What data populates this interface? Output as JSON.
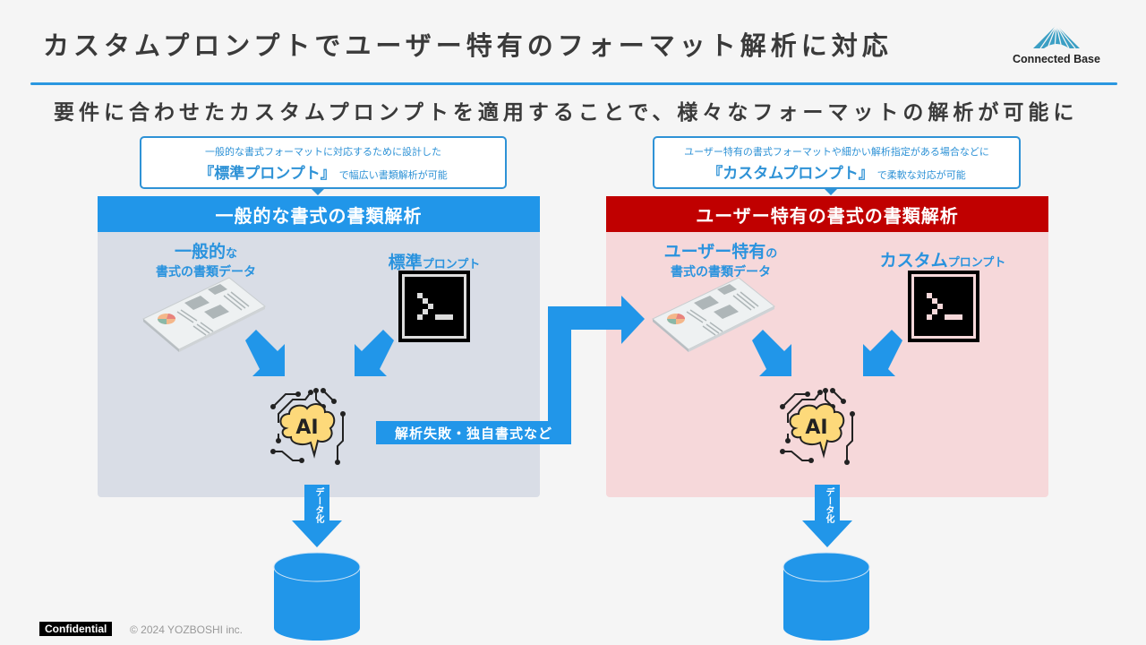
{
  "header": {
    "title": "カスタムプロンプトでユーザー特有のフォーマット解析に対応",
    "logo_text": "Connected Base",
    "subtitle": "要件に合わせたカスタムプロンプトを適用することで、様々なフォーマットの解析が可能に"
  },
  "left": {
    "callout_line1": "一般的な書式フォーマットに対応するために設計した",
    "callout_big": "『標準プロンプト』",
    "callout_small": "で幅広い書類解析が可能",
    "header": "一般的な書式の書類解析",
    "doc_label_big": "一般的",
    "doc_label_suffix": "な",
    "doc_label_line2": "書式の書類データ",
    "prompt_label_big": "標準",
    "prompt_label_small": "プロンプト",
    "ai_text": "AI",
    "data_arrow_label": "データ化"
  },
  "right": {
    "callout_line1": "ユーザー特有の書式フォーマットや細かい解析指定がある場合などに",
    "callout_big": "『カスタムプロンプト』",
    "callout_small": "で柔軟な対応が可能",
    "header": "ユーザー特有の書式の書類解析",
    "doc_label_big": "ユーザー特有",
    "doc_label_suffix": "の",
    "doc_label_line2": "書式の書類データ",
    "prompt_label_big": "カスタム",
    "prompt_label_small": "プロンプト",
    "ai_text": "AI",
    "data_arrow_label": "データ化"
  },
  "connector": {
    "label": "解析失敗・独自書式など"
  },
  "footer": {
    "confidential": "Confidential",
    "copyright": "© 2024 YOZBOSHI inc."
  },
  "colors": {
    "accent_blue": "#2196e9",
    "accent_red": "#c00000",
    "panel_left_bg": "#d9dde6",
    "panel_right_bg": "#f6d8da",
    "ai_cloud": "#fdd97a"
  }
}
